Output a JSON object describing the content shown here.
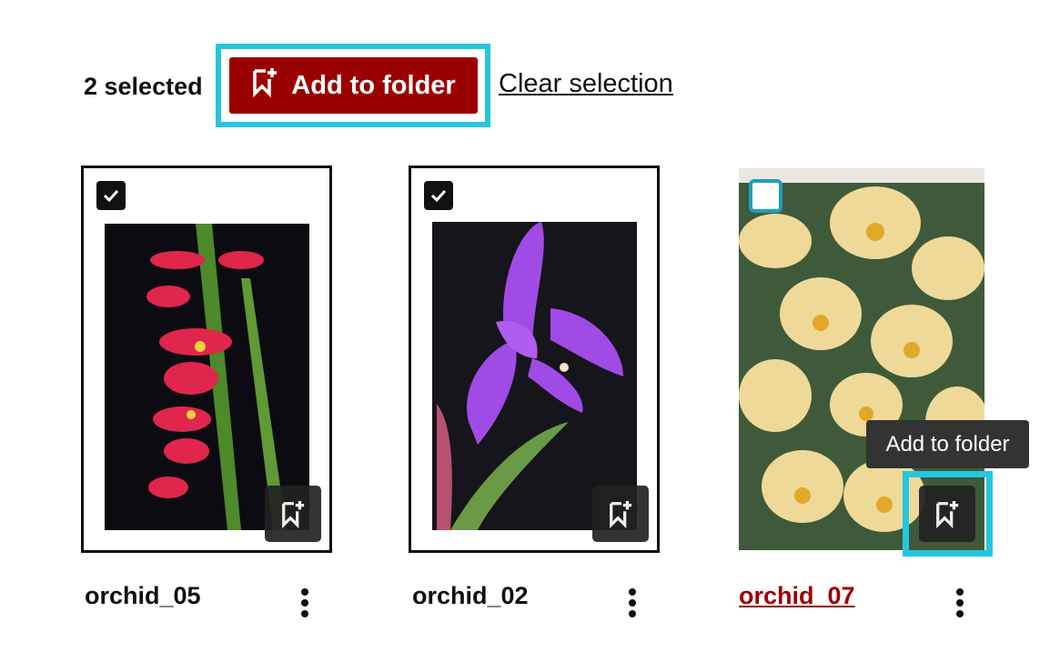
{
  "toolbar": {
    "selected_count": "2 selected",
    "add_to_folder_label": "Add to folder",
    "clear_selection_label": "Clear selection",
    "accent_color": "#9b0000",
    "highlight_color": "#26c6df"
  },
  "tooltip": {
    "text": "Add to folder"
  },
  "items": [
    {
      "name": "orchid_05",
      "selected": true,
      "image": "red orchid spray",
      "folder_button": "add-to-folder-icon"
    },
    {
      "name": "orchid_02",
      "selected": true,
      "image": "purple orchid",
      "folder_button": "add-to-folder-icon"
    },
    {
      "name": "orchid_07",
      "selected": false,
      "image": "yellow orchid cluster",
      "folder_button": "add-to-folder-icon"
    }
  ]
}
